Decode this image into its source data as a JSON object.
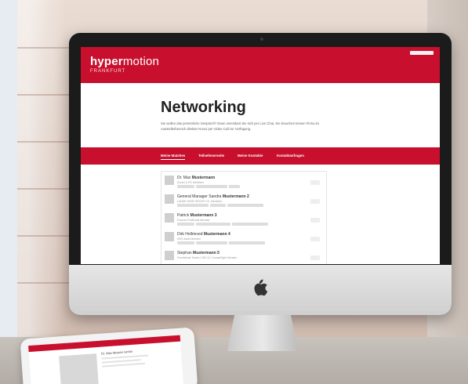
{
  "site": {
    "brand_strong": "hyper",
    "brand_light": "motion",
    "brand_sub": "FRANKFURT",
    "page_title": "Networking",
    "intro": "Sie wollen das persönliche Gespräch? Dann vereinbart Sie sich per Live Chat, Sie brauchen keinen Firma im Ausstellerbereich direkter Kreuz per Video Call zur Verfügung.",
    "nav": [
      "Meine Matches",
      "Teilnehmerseite",
      "Meine Kontakte",
      "Kontaktanfragen"
    ]
  },
  "people": [
    {
      "first": "Dr. Max",
      "last": "Mustermann",
      "company": "ExecU & RC Members"
    },
    {
      "first": "General Manager Sandra",
      "last": "Mustermann 2",
      "company": "LANDE NOSE GROUP CO, Members"
    },
    {
      "first": "Patrick",
      "last": "Mustermann 3",
      "company": "Fraunen Positional Member"
    },
    {
      "first": "Dirk Hollrieved",
      "last": "Mustermann 4",
      "company": "HRC Asset Member"
    },
    {
      "first": "Stephan",
      "last": "Mustermann 5",
      "company": "Frechfrenat Teuber LSM CO, HumanEight Member"
    }
  ],
  "tablet": {
    "name": "Dr. Max Musteri Gmbh"
  },
  "colors": {
    "brand_red": "#c8102e",
    "imac_bezel": "#1b1b1b"
  },
  "icons": [
    "apple-logo-icon",
    "avatar-icon"
  ]
}
